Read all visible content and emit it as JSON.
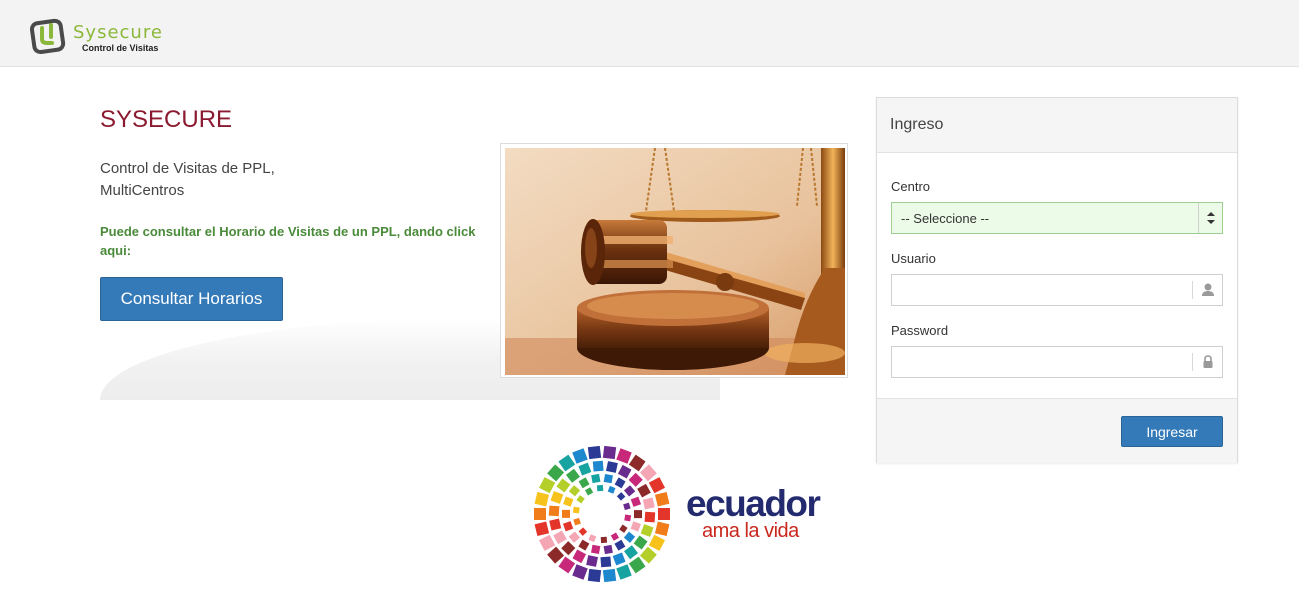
{
  "header": {
    "logo_name": "Sysecure",
    "logo_subtitle": "Control de Visitas"
  },
  "intro": {
    "title": "SYSECURE",
    "description_line1": "Control de Visitas de PPL,",
    "description_line2": "MultiCentros",
    "hint": "Puede consultar el Horario de Visitas de un PPL, dando click aqui:",
    "button_label": "Consultar Horarios"
  },
  "login": {
    "title": "Ingreso",
    "centro_label": "Centro",
    "centro_selected": "-- Seleccione --",
    "usuario_label": "Usuario",
    "usuario_value": "",
    "password_label": "Password",
    "password_value": "",
    "submit_label": "Ingresar",
    "user_icon": "user-icon",
    "lock_icon": "lock-icon"
  },
  "footer_logo": {
    "word": "ecuador",
    "tagline": "ama la vida"
  },
  "colors": {
    "brand_green": "#8bb83a",
    "title_red": "#8b1a30",
    "hint_green": "#4a8a3a",
    "button_blue": "#357ab8",
    "select_bg": "#ecfbe8",
    "ecuador_blue": "#232a6e",
    "ecuador_red": "#c8281e"
  }
}
